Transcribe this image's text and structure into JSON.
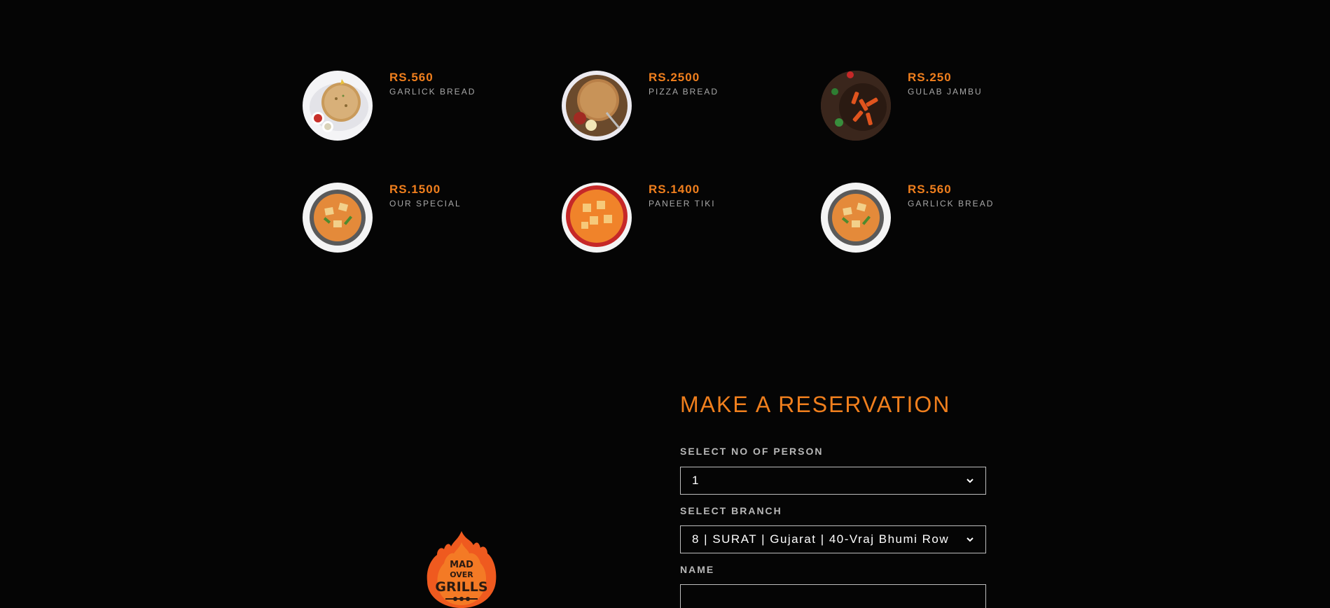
{
  "menu": {
    "items": [
      {
        "price": "RS.560",
        "name": "GARLICK BREAD",
        "image": "garlic-bread-plate"
      },
      {
        "price": "RS.2500",
        "name": "PIZZA BREAD",
        "image": "pizza-bread-plate"
      },
      {
        "price": "RS.250",
        "name": "GULAB JAMBU",
        "image": "pasta-board"
      },
      {
        "price": "RS.1500",
        "name": "OUR SPECIAL",
        "image": "curry-bowl"
      },
      {
        "price": "RS.1400",
        "name": "PANEER TIKI",
        "image": "paneer-bowl"
      },
      {
        "price": "RS.560",
        "name": "GARLICK BREAD",
        "image": "curry-bowl"
      }
    ]
  },
  "reservation": {
    "title": "MAKE A RESERVATION",
    "persons_label": "SELECT NO OF PERSON",
    "persons_value": "1",
    "branch_label": "SELECT BRANCH",
    "branch_value": "8 | SURAT | Gujarat | 40-Vraj Bhumi Row",
    "name_label": "NAME",
    "name_value": ""
  },
  "logo": {
    "line1": "MAD",
    "line2": "OVER",
    "line3": "GRILLS"
  },
  "colors": {
    "accent": "#f07f1d",
    "background": "#050505",
    "muted": "#a8a8a8"
  }
}
